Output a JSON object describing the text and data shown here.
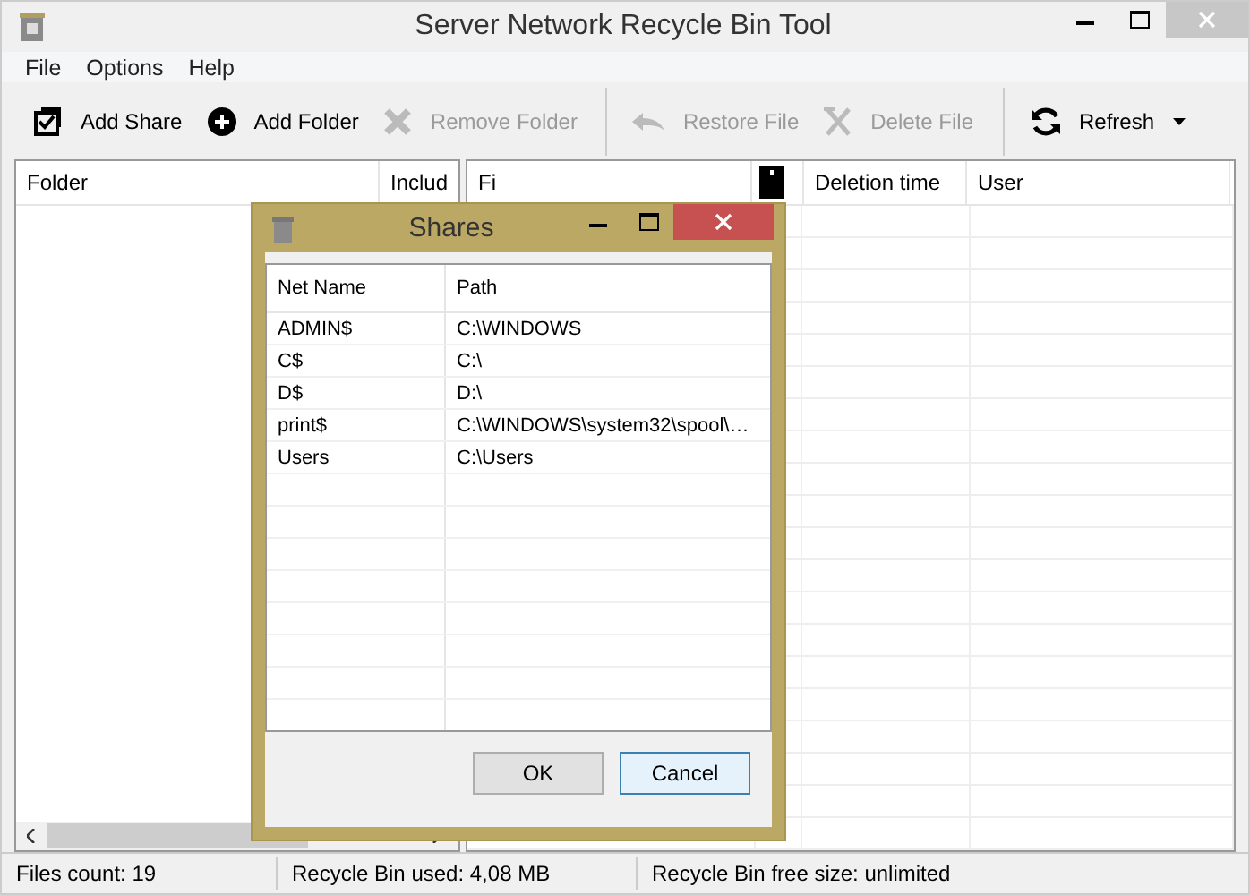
{
  "window": {
    "title": "Server Network Recycle Bin Tool"
  },
  "menu": [
    "File",
    "Options",
    "Help"
  ],
  "toolbar": [
    {
      "label": "Add Share",
      "kind": "add-share",
      "disabled": false
    },
    {
      "label": "Add Folder",
      "kind": "add-folder",
      "disabled": false
    },
    {
      "label": "Remove Folder",
      "kind": "remove",
      "disabled": true
    },
    {
      "label": "Restore File",
      "kind": "restore",
      "disabled": true
    },
    {
      "label": "Delete File",
      "kind": "delete",
      "disabled": true
    },
    {
      "label": "Refresh",
      "kind": "refresh",
      "disabled": false
    }
  ],
  "folders_table": {
    "columns": [
      "Folder",
      "Includ"
    ]
  },
  "files_table": {
    "columns": [
      "Fi",
      "Deletion time",
      "User"
    ]
  },
  "dialog": {
    "title": "Shares",
    "columns": [
      "Net Name",
      "Path"
    ],
    "rows": [
      {
        "net_name": "ADMIN$",
        "path": "C:\\WINDOWS"
      },
      {
        "net_name": "C$",
        "path": "C:\\"
      },
      {
        "net_name": "D$",
        "path": "D:\\"
      },
      {
        "net_name": "print$",
        "path": "C:\\WINDOWS\\system32\\spool\\…"
      },
      {
        "net_name": "Users",
        "path": "C:\\Users"
      }
    ],
    "buttons": [
      "OK",
      "Cancel"
    ]
  },
  "status_bar": [
    "Files count: 19",
    "Recycle Bin used: 4,08 MB",
    "Recycle Bin free size: unlimited"
  ]
}
